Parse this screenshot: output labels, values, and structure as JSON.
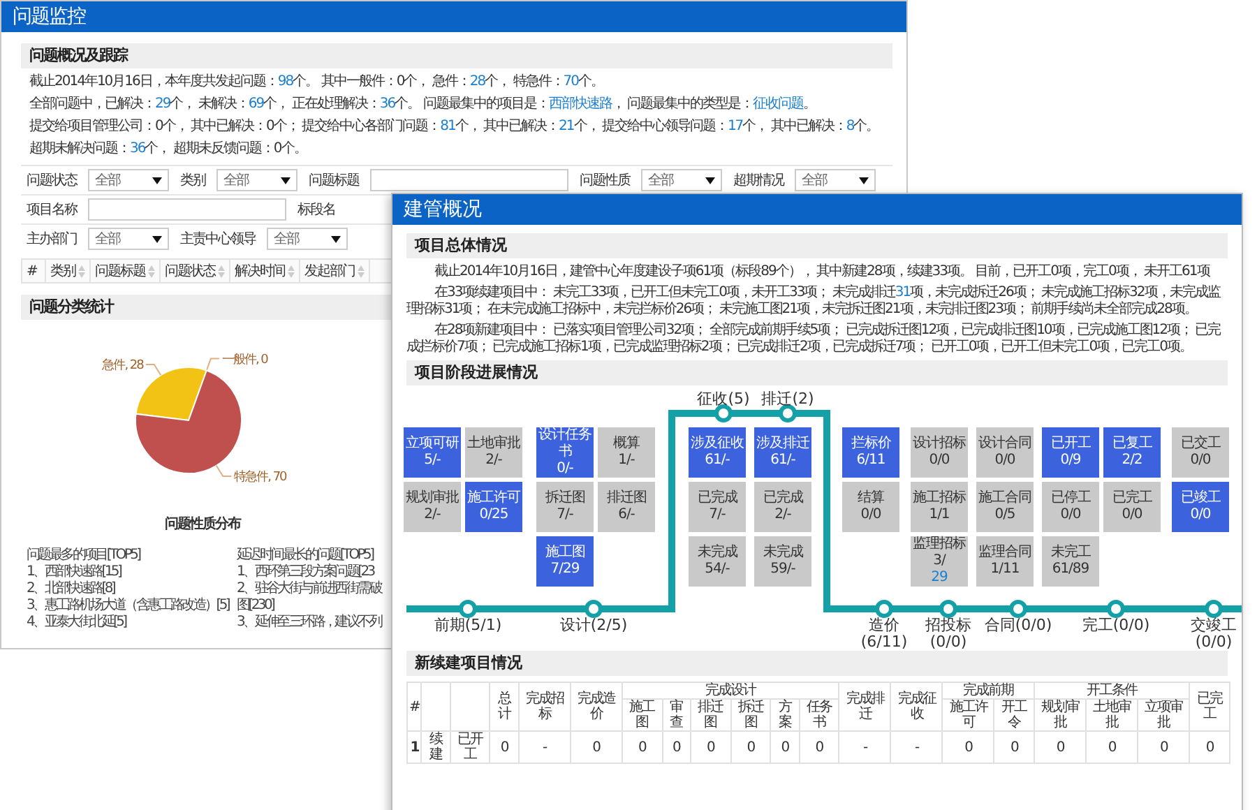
{
  "back_window": {
    "title": "问题监控",
    "overview": {
      "heading": "问题概况及跟踪",
      "lines": [
        [
          {
            "text": "截止2014年10月16日，本年度共发起问题："
          },
          {
            "text": "98",
            "link": true
          },
          {
            "text": "个。 其中一般件：0个， 急件："
          },
          {
            "text": "28",
            "link": true
          },
          {
            "text": "个， 特急件："
          },
          {
            "text": "70",
            "link": true
          },
          {
            "text": "个。"
          }
        ],
        [
          {
            "text": "全部问题中，已解决："
          },
          {
            "text": "29",
            "link": true
          },
          {
            "text": "个， 未解决："
          },
          {
            "text": "69",
            "link": true
          },
          {
            "text": "个， 正在处理解决："
          },
          {
            "text": "36",
            "link": true
          },
          {
            "text": "个。 问题最集中的项目是："
          },
          {
            "text": "西部快速路",
            "link": true
          },
          {
            "text": "， 问题最集中的类型是："
          },
          {
            "text": "征收问题",
            "link": true
          },
          {
            "text": "。"
          }
        ],
        [
          {
            "text": "提交给项目管理公司：0个， 其中已解决：0个； 提交给中心各部门问题："
          },
          {
            "text": "81",
            "link": true
          },
          {
            "text": "个， 其中已解决："
          },
          {
            "text": "21",
            "link": true
          },
          {
            "text": "个， 提交给中心领导问题："
          },
          {
            "text": "17",
            "link": true
          },
          {
            "text": "个， 其中已解决："
          },
          {
            "text": "8",
            "link": true
          },
          {
            "text": "个。"
          }
        ],
        [
          {
            "text": "超期未解决问题："
          },
          {
            "text": "36",
            "link": true
          },
          {
            "text": "个， 超期未反馈问题：0个。"
          }
        ]
      ]
    },
    "filters": [
      [
        {
          "kind": "select",
          "label": "问题状态",
          "value": "全部"
        },
        {
          "kind": "select",
          "label": "类别",
          "value": "全部"
        },
        {
          "kind": "input",
          "label": "问题标题"
        },
        {
          "kind": "select",
          "label": "问题性质",
          "value": "全部"
        },
        {
          "kind": "select",
          "label": "超期情况",
          "value": "全部"
        }
      ],
      [
        {
          "kind": "input",
          "label": "项目名称"
        },
        {
          "kind": "label",
          "label": "标段名"
        }
      ],
      [
        {
          "kind": "select",
          "label": "主办部门",
          "value": "全部"
        },
        {
          "kind": "select",
          "label": "主责中心领导",
          "value": "全部"
        }
      ]
    ],
    "table_columns": [
      "#",
      "类别",
      "问题标题",
      "问题状态",
      "解决时间",
      "发起部门"
    ],
    "stats": {
      "heading": "问题分类统计",
      "chart_data": {
        "type": "pie",
        "title": "问题性质分布",
        "categories": [
          "急件",
          "一般件",
          "特急件"
        ],
        "values": [
          28,
          0,
          70
        ],
        "value_labels": [
          ", 28",
          ", 0",
          ", 70"
        ]
      }
    },
    "top_lists": [
      {
        "title": "问题最多的项目[TOP5]",
        "items": [
          "1、西部快速路[15]",
          "2、北部快速路[8]",
          "3、惠工路机场大道（含惠工路改造）[5]",
          "4、亚泰大街北延[5]"
        ]
      },
      {
        "title": "延迟时间最长的问题[TOP5]",
        "items": [
          "1、西环第三段方案问题[23",
          "2、驻谷大街与前进西街需破",
          "图[230]",
          "3、延伸至三环路，建议不列"
        ]
      }
    ]
  },
  "front_window": {
    "title": "建管概况",
    "summary": {
      "heading": "项目总体情况",
      "paragraphs": [
        [
          {
            "text": "截止2014年10月16日，建管中心年度建设子项61项（标段89个）， 其中新建28项，续建33项。 目前，已开工0项，完工0项， 未开工61项"
          }
        ],
        [
          {
            "text": "在33项续建项目中： 未完工33项，已开工但未完工0项，未开工33项； 未完成排迁"
          },
          {
            "text": "31",
            "link": true
          },
          {
            "text": "项，未完成拆迁26项； 未完成施工招标32项，未完成监理招标31项； 在未完成施工招标中，未完拦标价26项； 未完施工图21项，未完拆迁图21项，未完排迁图23项； 前期手续尚未全部完成28项。"
          }
        ],
        [
          {
            "text": "在28项新建项目中： 已落实项目管理公司32项； 全部完成前期手续5项； 已完成拆迁图12项，已完成排迁图10项，已完成施工图12项； 已完成拦标价7项； 已完成施工招标1项，已完成监理招标2项； 已完成排迁2项，已完成拆迁7项； 已开工0项，已开工但未完工0项，已完工0项。"
          }
        ]
      ]
    },
    "progress": {
      "heading": "项目阶段进展情况",
      "columns": [
        [
          {
            "label": "立项可研",
            "value": "5/-",
            "active": true
          },
          {
            "label": "规划审批",
            "value": "2/-",
            "active": false
          }
        ],
        [
          {
            "label": "土地审批",
            "value": "2/-",
            "active": false
          },
          {
            "label": "施工许可",
            "value": "0/25",
            "active": true
          }
        ],
        [
          {
            "label": "设计任务书",
            "value": "0/-",
            "active": true
          },
          {
            "label": "拆迁图",
            "value": "7/-",
            "active": false
          },
          {
            "label": "施工图",
            "value": "7/29",
            "active": true
          }
        ],
        [
          {
            "label": "概算",
            "value": "1/-",
            "active": false
          },
          {
            "label": "排迁图",
            "value": "6/-",
            "active": false
          }
        ],
        [
          {
            "label": "涉及征收",
            "value": "61/-",
            "active": true
          },
          {
            "label": "已完成",
            "value": "7/-",
            "active": false
          },
          {
            "label": "未完成",
            "value": "54/-",
            "active": false
          }
        ],
        [
          {
            "label": "涉及排迁",
            "value": "61/-",
            "active": true
          },
          {
            "label": "已完成",
            "value": "2/-",
            "active": false
          },
          {
            "label": "未完成",
            "value": "59/-",
            "active": false
          }
        ],
        [
          {
            "label": "拦标价",
            "value": "6/11",
            "active": true
          },
          {
            "label": "结算",
            "value": "0/0",
            "active": false
          }
        ],
        [
          {
            "label": "设计招标",
            "value": "0/0",
            "active": false
          },
          {
            "label": "施工招标",
            "value": "1/1",
            "active": false
          },
          {
            "label": "监理招标",
            "value": "3/",
            "value_link": "29",
            "active": false
          }
        ],
        [
          {
            "label": "设计合同",
            "value": "0/0",
            "active": false
          },
          {
            "label": "施工合同",
            "value": "0/5",
            "active": false
          },
          {
            "label": "监理合同",
            "value": "1/11",
            "active": false
          }
        ],
        [
          {
            "label": "已开工",
            "value": "0/9",
            "active": true
          },
          {
            "label": "已停工",
            "value": "0/0",
            "active": false
          },
          {
            "label": "未完工",
            "value": "61/89",
            "active": false
          }
        ],
        [
          {
            "label": "已复工",
            "value": "2/2",
            "active": true
          },
          {
            "label": "已完工",
            "value": "0/0",
            "active": false
          }
        ],
        [
          {
            "label": "已交工",
            "value": "0/0",
            "active": false
          },
          {
            "label": "已竣工",
            "value": "0/0",
            "active": true
          }
        ]
      ],
      "stations": [
        {
          "label": "前期",
          "count": "(5/1)",
          "kind": "bottom",
          "stacked": false
        },
        {
          "label": "设计",
          "count": "(2/5)",
          "kind": "bottom",
          "stacked": false
        },
        {
          "label": "征收",
          "count": "(5)",
          "kind": "top",
          "stacked": false
        },
        {
          "label": "排迁",
          "count": "(2)",
          "kind": "top",
          "stacked": false
        },
        {
          "label": "造价",
          "count": "(6/11)",
          "kind": "bottom",
          "stacked": true
        },
        {
          "label": "招投标",
          "count": "(0/0)",
          "kind": "bottom",
          "stacked": true
        },
        {
          "label": "合同",
          "count": "(0/0)",
          "kind": "bottom",
          "stacked": false
        },
        {
          "label": "完工",
          "count": "(0/0)",
          "kind": "bottom",
          "stacked": false
        },
        {
          "label": "交竣工",
          "count": "(0/0)",
          "kind": "bottom",
          "stacked": true
        }
      ]
    },
    "projects": {
      "heading": "新续建项目情况",
      "columns": [
        {
          "kind": "header",
          "label": "#"
        },
        {
          "kind": "blank"
        },
        {
          "kind": "blank"
        },
        {
          "kind": "header",
          "label": "总计"
        },
        {
          "kind": "header",
          "label": "完成招标"
        },
        {
          "kind": "header",
          "label": "完成造价"
        },
        {
          "kind": "group",
          "label": "完成设计",
          "colspan": 6,
          "children": [
            "施工图",
            "审查",
            "排迁图",
            "拆迁图",
            "方案",
            "任务书"
          ]
        },
        {
          "kind": "header",
          "label": "完成排迁"
        },
        {
          "kind": "header",
          "label": "完成征收"
        },
        {
          "kind": "group",
          "label": "完成前期",
          "colspan": 2,
          "children": [
            "施工许可",
            "开工令"
          ]
        },
        {
          "kind": "group",
          "label": "开工条件",
          "colspan": 3,
          "children": [
            "规划审批",
            "土地审批",
            "立项审批"
          ]
        },
        {
          "kind": "header",
          "label": "已完工"
        }
      ],
      "rows": [
        {
          "cells": [
            "1",
            "续建",
            "已开工",
            "0",
            "-",
            "0",
            "0",
            "0",
            "0",
            "0",
            "0",
            "0",
            "-",
            "-",
            "0",
            "0",
            "0",
            "0",
            "0",
            "0"
          ]
        }
      ]
    }
  }
}
